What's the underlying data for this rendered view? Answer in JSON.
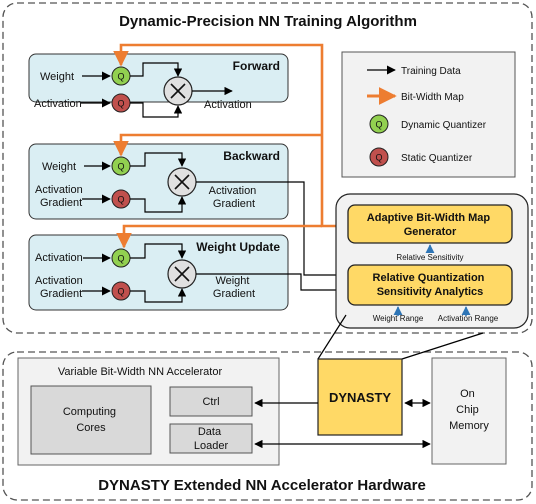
{
  "diagram": {
    "top_section_title": "Dynamic-Precision NN Training Algorithm",
    "bottom_section_title": "DYNASTY Extended NN Accelerator Hardware",
    "quantizer_symbol": "Q",
    "stages": [
      {
        "title": "Forward",
        "input_top": "Weight",
        "input_bottom": [
          "Activation"
        ],
        "output": [
          "Activation"
        ]
      },
      {
        "title": "Backward",
        "input_top": "Weight",
        "input_bottom": [
          "Activation",
          "Gradient"
        ],
        "output": [
          "Activation",
          "Gradient"
        ]
      },
      {
        "title": "Weight Update",
        "input_top": "Activation",
        "input_bottom": [
          "Activation",
          "Gradient"
        ],
        "output": [
          "Weight",
          "Gradient"
        ]
      }
    ],
    "legend": {
      "items": [
        {
          "icon": "black-arrow-icon",
          "label": "Training Data"
        },
        {
          "icon": "orange-arrow-icon",
          "label": "Bit-Width Map"
        },
        {
          "icon": "green-q-circle-icon",
          "label": "Dynamic Quantizer"
        },
        {
          "icon": "red-q-circle-icon",
          "label": "Static Quantizer"
        }
      ]
    },
    "dynasty_module": {
      "generator": [
        "Adaptive Bit-Width Map",
        "Generator"
      ],
      "relative_sensitivity": "Relative Sensitivity",
      "analytics": [
        "Relative Quantization",
        "Sensitivity Analytics"
      ],
      "weight_range": "Weight Range",
      "activation_range": "Activation Range"
    },
    "hardware": {
      "accelerator_title": "Variable Bit-Width NN Accelerator",
      "computing_cores": [
        "Computing",
        "Cores"
      ],
      "ctrl": "Ctrl",
      "data_loader": [
        "Data",
        "Loader"
      ],
      "dynasty": "DYNASTY",
      "memory": [
        "On",
        "Chip",
        "Memory"
      ]
    },
    "colors": {
      "orange": "#ED7D31",
      "dynamic_quantizer": "#92D050",
      "static_quantizer": "#C0504D",
      "stage_fill": "#DAEEF3",
      "yellow": "#FFD966",
      "blue_arrow": "#2E75B6"
    }
  }
}
